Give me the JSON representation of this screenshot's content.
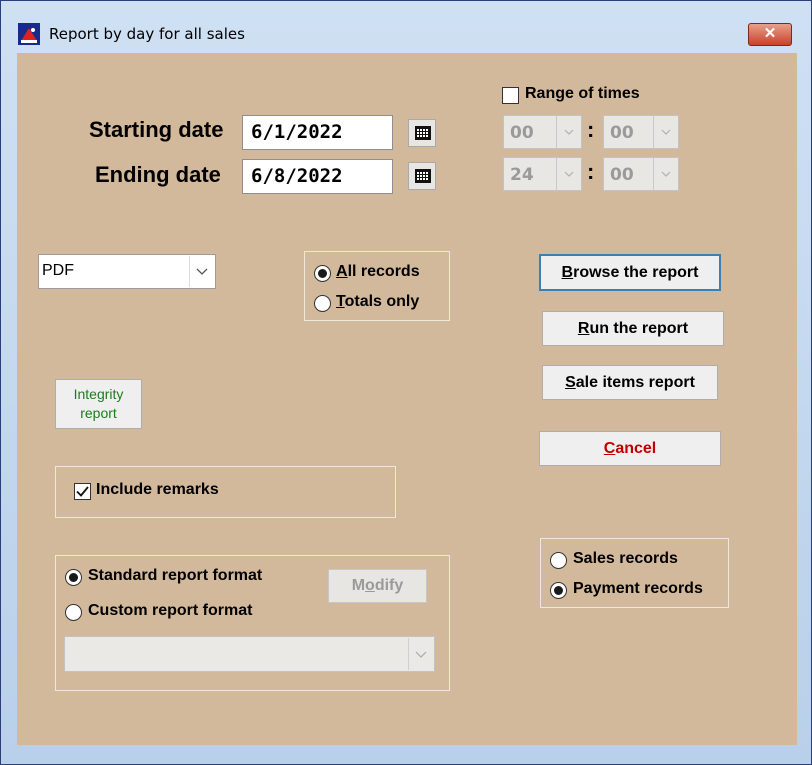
{
  "window": {
    "title": "Report by day for all sales",
    "close_glyph": "✕"
  },
  "dates": {
    "start_label": "Starting date",
    "start_value": "6/1/2022",
    "end_label": "Ending date",
    "end_value": "6/8/2022"
  },
  "range_of_times": {
    "label": "Range of times",
    "checked": false,
    "start_hour": "00",
    "start_minute": "00",
    "end_hour": "24",
    "end_minute": "00",
    "separator": ":"
  },
  "output_format": {
    "selected": "PDF"
  },
  "records_scope": {
    "options": [
      {
        "accel": "A",
        "rest": "ll records",
        "selected": true
      },
      {
        "accel": "T",
        "rest": "otals only",
        "selected": false
      }
    ]
  },
  "buttons": {
    "browse": {
      "accel": "B",
      "rest": "rowse the report"
    },
    "run": {
      "accel": "R",
      "rest": "un the report"
    },
    "sale_items": {
      "accel": "S",
      "rest": "ale items report"
    },
    "cancel": {
      "accel": "C",
      "rest": "ancel"
    },
    "integrity_line1": "Integrity",
    "integrity_line2": "report",
    "modify_pre": "M",
    "modify_accel": "o",
    "modify_post": "dify"
  },
  "include_remarks": {
    "label": "Include remarks",
    "checked": true
  },
  "report_format": {
    "standard_label": "Standard report format",
    "custom_label": "Custom report format",
    "selected": "standard",
    "custom_value": ""
  },
  "record_type": {
    "sales_label": "Sales records",
    "payment_label": "Payment records",
    "selected": "payment"
  },
  "colors": {
    "dialog_bg": "#d3b99c",
    "cancel_text": "#c00000",
    "integrity_text": "#1f7a1f",
    "title_bar_bg": "#cfe0f3"
  },
  "icons": [
    "app-icon",
    "calendar-icon",
    "chevron-down-icon",
    "checkmark-icon",
    "close-icon"
  ]
}
